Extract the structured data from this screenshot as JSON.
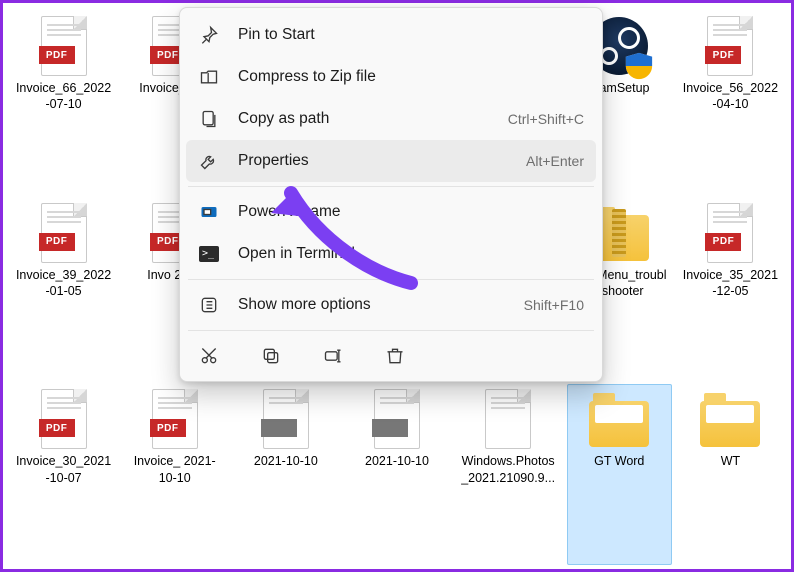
{
  "pdf_badge": "PDF",
  "files": {
    "r0c0": "Invoice_66_2022-07-10",
    "r0c1": "Invoice_\n202",
    "r0c5": "teamSetup",
    "r0c6": "Invoice_56_2022-04-10",
    "r1c0": "Invoice_39_2022-01-05",
    "r1c1": "Invo\n2021",
    "r1c5": "tart_Menu_troubleshooter",
    "r1c6": "Invoice_35_2021-12-05",
    "r2c0": "Invoice_30_2021-10-07",
    "r2c1": "Invoice_\n2021-10-10",
    "r2c2": "2021-10-10",
    "r2c3": "2021-10-10",
    "r2c4": "Windows.Photos_2021.21090.9...",
    "r2c5": "GT Word",
    "r2c6": "WT"
  },
  "context_menu": {
    "pin": "Pin to Start",
    "zip": "Compress to Zip file",
    "copy_path": "Copy as path",
    "copy_path_short": "Ctrl+Shift+C",
    "properties": "Properties",
    "properties_short": "Alt+Enter",
    "powerrename": "PowerRename",
    "terminal": "Open in Terminal",
    "more": "Show more options",
    "more_short": "Shift+F10"
  }
}
